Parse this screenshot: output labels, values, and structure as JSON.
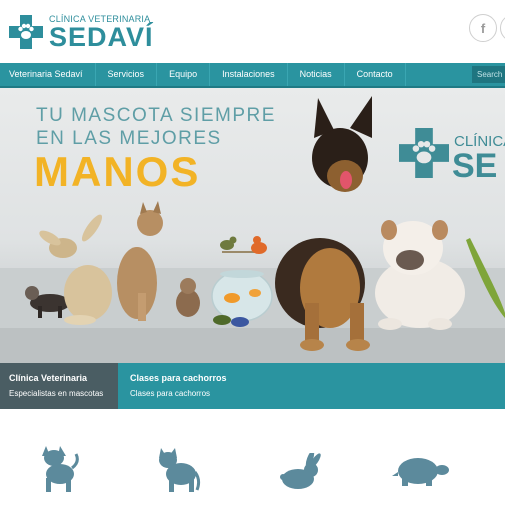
{
  "header": {
    "logo_small": "CLÍNICA VETERINARIA",
    "logo_big": "SEDAVÍ",
    "social": [
      {
        "label": "f",
        "icon": "facebook-icon"
      },
      {
        "label": "",
        "icon": "social-icon"
      }
    ]
  },
  "nav": {
    "items": [
      "Veterinaria Sedaví",
      "Servicios",
      "Equipo",
      "Instalaciones",
      "Noticias",
      "Contacto"
    ],
    "search_placeholder": "Search"
  },
  "hero": {
    "line1": "TU MASCOTA SIEMPRE",
    "line2": "EN LAS MEJORES",
    "line3": "MANOS",
    "brand_small": "CLÍNICA",
    "brand_big": "SE"
  },
  "tabs": [
    {
      "title": "Clínica Veterinaria",
      "subtitle": "Especialistas en mascotas",
      "active": true
    },
    {
      "title": "Clases para cachorros",
      "subtitle": "Clases para cachorros",
      "active": false
    }
  ],
  "animals": [
    "dog-icon",
    "cat-icon",
    "rabbit-icon",
    "turtle-icon"
  ],
  "colors": {
    "teal": "#2a94a0",
    "teal_dark": "#1f7a85",
    "accent_yellow": "#f2b326",
    "icon_slate": "#5c8a9c",
    "tab_active": "#4a5d63"
  }
}
